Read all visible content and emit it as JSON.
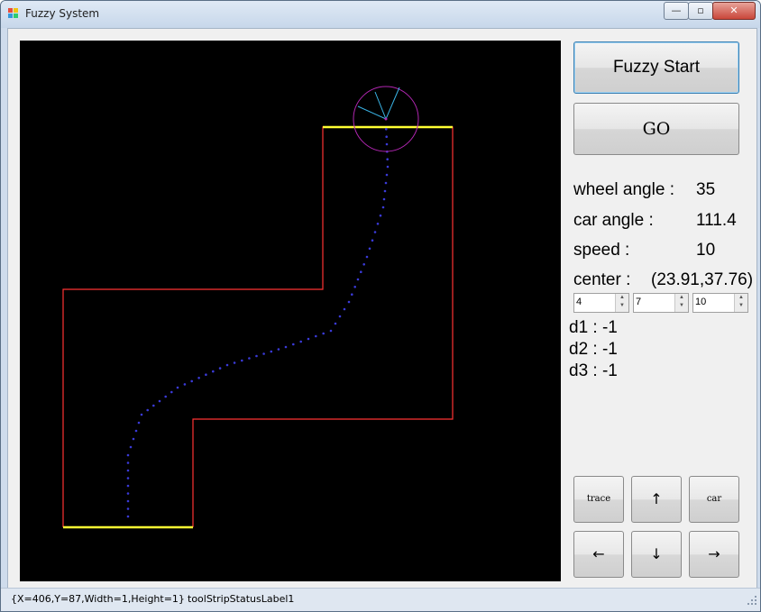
{
  "window": {
    "title": "Fuzzy System",
    "controls": {
      "minimize": "—",
      "maximize": "▫",
      "close": "✕"
    }
  },
  "icons": {
    "app": "app-icon",
    "minimize": "minimize-icon",
    "maximize": "maximize-icon",
    "close": "close-icon",
    "arrows": [
      "arrow-up-icon",
      "arrow-left-icon",
      "arrow-down-icon",
      "arrow-right-icon"
    ]
  },
  "colors": {
    "canvas_bg": "#000000",
    "track_wall": "#ff3333",
    "start_finish_line": "#ffff33",
    "trace_dots": "#3a3ad8",
    "car_circle": "#b026b0",
    "sensor_rays": "#3ab4e6"
  },
  "buttons": {
    "fuzzy_start": "Fuzzy Start",
    "go": "GO",
    "trace": "trace",
    "up": "↑",
    "car": "car",
    "left": "←",
    "down": "↓",
    "right": "→"
  },
  "info": {
    "wheel_angle_label": "wheel angle :",
    "wheel_angle_value": "35",
    "car_angle_label": "car angle :",
    "car_angle_value": "111.4",
    "speed_label": "speed :",
    "speed_value": "10",
    "center_label": "center :",
    "center_value": "(23.91,37.76)"
  },
  "inputs": [
    {
      "value": "4"
    },
    {
      "value": "7"
    },
    {
      "value": "10"
    }
  ],
  "distances": {
    "d1": "d1 :  -1",
    "d2": "d2 :  -1",
    "d3": "d3 :  -1"
  },
  "status": {
    "bounds": "{X=406,Y=87,Width=1,Height=1}",
    "label": "toolStripStatusLabel1"
  }
}
